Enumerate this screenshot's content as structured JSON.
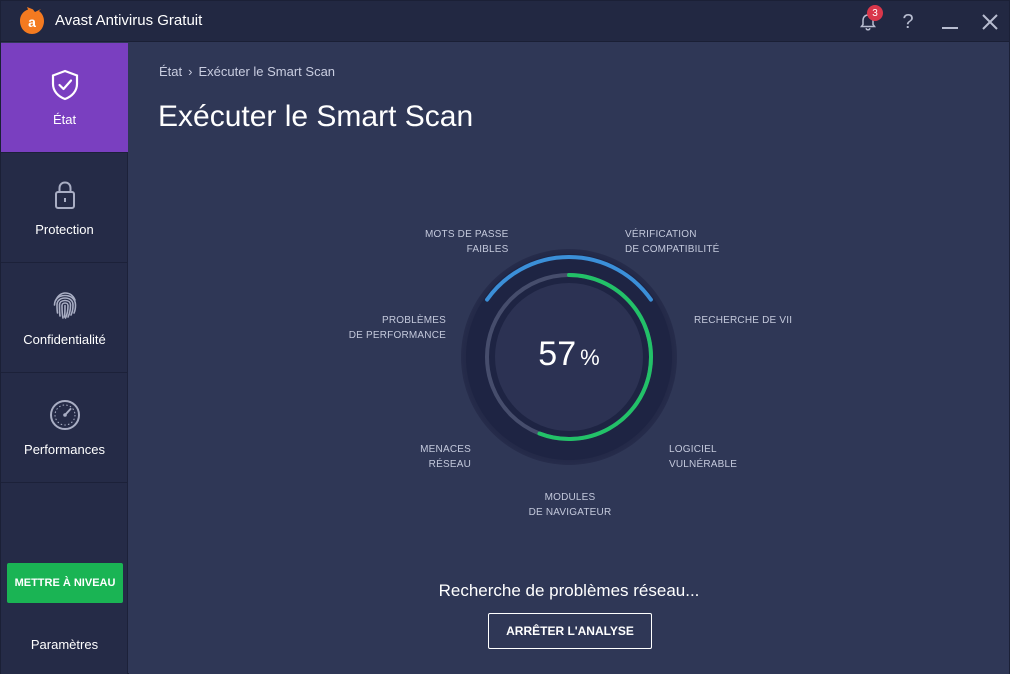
{
  "app": {
    "title": "Avast Antivirus Gratuit",
    "notification_count": "3",
    "help_symbol": "?"
  },
  "colors": {
    "accent_purple": "#7a3fc0",
    "upgrade_green": "#1ab454",
    "progress_green": "#22c168",
    "progress_blue": "#3b8fd8",
    "badge_red": "#d9374b"
  },
  "sidebar": {
    "items": [
      {
        "label": "État",
        "icon": "shield-check-icon",
        "active": true
      },
      {
        "label": "Protection",
        "icon": "lock-icon",
        "active": false
      },
      {
        "label": "Confidentialité",
        "icon": "fingerprint-icon",
        "active": false
      },
      {
        "label": "Performances",
        "icon": "speedometer-icon",
        "active": false
      }
    ],
    "upgrade_label": "METTRE À NIVEAU",
    "settings_label": "Paramètres"
  },
  "main": {
    "breadcrumb": {
      "root": "État",
      "separator": "›",
      "current": "Exécuter le Smart Scan"
    },
    "title": "Exécuter le Smart Scan",
    "scan": {
      "progress_value": "57",
      "progress_unit": "%",
      "labels": {
        "weak_passwords": [
          "MOTS DE PASSE",
          "FAIBLES"
        ],
        "compatibility": [
          "VÉRIFICATION",
          "DE COMPATIBILITÉ"
        ],
        "virus_search": [
          "RECHERCHE DE VII"
        ],
        "vulnerable_software": [
          "LOGICIEL",
          "VULNÉRABLE"
        ],
        "browser_modules": [
          "MODULES",
          "DE NAVIGATEUR"
        ],
        "network_threats": [
          "MENACES",
          "RÉSEAU"
        ],
        "performance_issues": [
          "PROBLÈMES",
          "DE PERFORMANCE"
        ]
      }
    },
    "status": "Recherche de problèmes réseau...",
    "stop_label": "ARRÊTER L'ANALYSE"
  }
}
